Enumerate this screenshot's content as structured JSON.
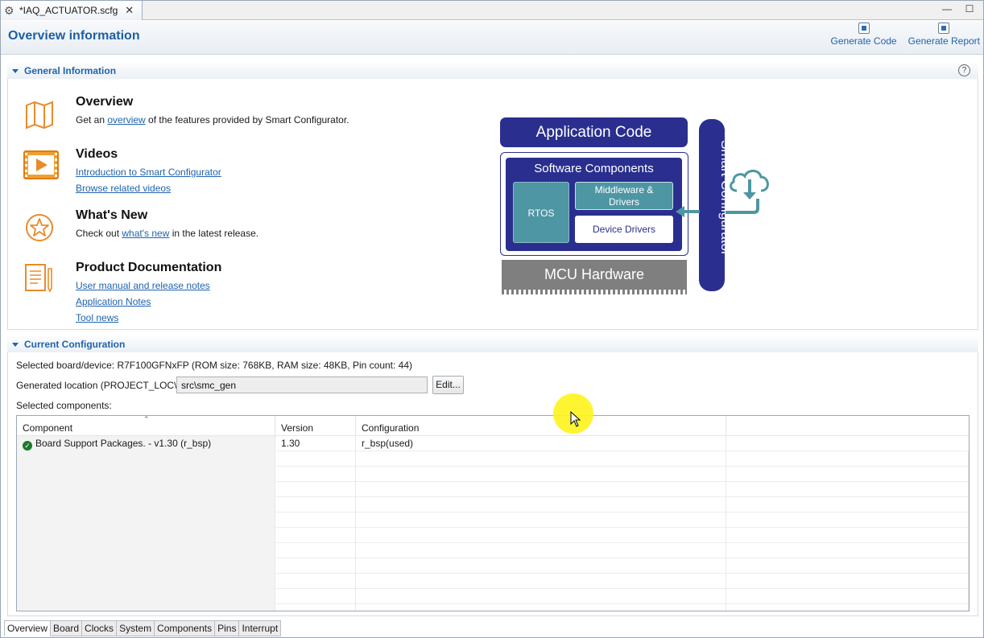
{
  "editor_tab": {
    "title": "*IAQ_ACTUATOR.scfg",
    "close": "✕"
  },
  "window_buttons": {
    "minimize": "—",
    "maximize": "☐"
  },
  "header": {
    "title": "Overview information",
    "generate_code": "Generate Code",
    "generate_report": "Generate Report"
  },
  "general": {
    "section_label": "General Information",
    "help": "?",
    "overview": {
      "title": "Overview",
      "pre": "Get an ",
      "link": "overview",
      "post": " of the features provided by Smart Configurator."
    },
    "videos": {
      "title": "Videos",
      "link1": "Introduction to Smart Configurator",
      "link2": "Browse related videos"
    },
    "whats_new": {
      "title": "What's New",
      "pre": "Check out ",
      "link": "what's new",
      "post": " in the latest release."
    },
    "docs": {
      "title": "Product Documentation",
      "link1": "User manual and release notes",
      "link2": "Application Notes",
      "link3": "Tool news"
    }
  },
  "diagram": {
    "app_code": "Application Code",
    "sw_components": "Software Components",
    "rtos": "RTOS",
    "middleware_1": "Middleware &",
    "middleware_2": "Drivers",
    "device_drivers": "Device Drivers",
    "mcu": "MCU Hardware",
    "smart_configurator": "Smart Configurator"
  },
  "config": {
    "section_label": "Current Configuration",
    "board_label": "Selected board/device:",
    "board_value": "R7F100GFNxFP (ROM size: 768KB, RAM size: 48KB, Pin count: 44)",
    "location_label": "Generated location (PROJECT_LOC\\):",
    "location_value": "src\\smc_gen",
    "edit_button": "Edit...",
    "components_label": "Selected components:",
    "columns": [
      "Component",
      "Version",
      "Configuration"
    ],
    "rows": [
      {
        "component": "Board Support Packages. - v1.30 (r_bsp)",
        "version": "1.30",
        "configuration": "r_bsp(used)"
      }
    ]
  },
  "bottom_tabs": [
    "Overview",
    "Board",
    "Clocks",
    "System",
    "Components",
    "Pins",
    "Interrupt"
  ]
}
